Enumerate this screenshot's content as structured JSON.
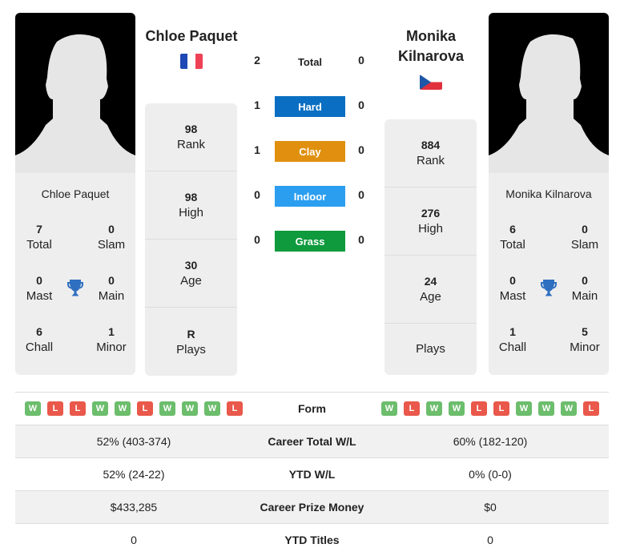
{
  "player1": {
    "name": "Chloe Paquet",
    "country": "France",
    "flag_icon": "flag-france",
    "rank": "98",
    "rank_label": "Rank",
    "high": "98",
    "high_label": "High",
    "age": "30",
    "age_label": "Age",
    "plays": "R",
    "plays_label": "Plays",
    "titles": {
      "total": "7",
      "total_label": "Total",
      "slam": "0",
      "slam_label": "Slam",
      "mast": "0",
      "mast_label": "Mast",
      "main": "0",
      "main_label": "Main",
      "chall": "6",
      "chall_label": "Chall",
      "minor": "1",
      "minor_label": "Minor"
    },
    "form": [
      "W",
      "L",
      "L",
      "W",
      "W",
      "L",
      "W",
      "W",
      "W",
      "L"
    ]
  },
  "player2": {
    "name": "Monika Kilnarova",
    "name_line1": "Monika",
    "name_line2": "Kilnarova",
    "country": "Czech Republic",
    "flag_icon": "flag-czech",
    "rank": "884",
    "rank_label": "Rank",
    "high": "276",
    "high_label": "High",
    "age": "24",
    "age_label": "Age",
    "plays": "",
    "plays_label": "Plays",
    "titles": {
      "total": "6",
      "total_label": "Total",
      "slam": "0",
      "slam_label": "Slam",
      "mast": "0",
      "mast_label": "Mast",
      "main": "0",
      "main_label": "Main",
      "chall": "1",
      "chall_label": "Chall",
      "minor": "5",
      "minor_label": "Minor"
    },
    "form": [
      "W",
      "L",
      "W",
      "W",
      "L",
      "L",
      "W",
      "W",
      "W",
      "L"
    ]
  },
  "h2h": {
    "total": {
      "label": "Total",
      "p1": "2",
      "p2": "0"
    },
    "surfaces": [
      {
        "label": "Hard",
        "p1": "1",
        "p2": "0",
        "color": "#0a6fc2"
      },
      {
        "label": "Clay",
        "p1": "1",
        "p2": "0",
        "color": "#e0900e"
      },
      {
        "label": "Indoor",
        "p1": "0",
        "p2": "0",
        "color": "#2b9ef0"
      },
      {
        "label": "Grass",
        "p1": "0",
        "p2": "0",
        "color": "#0e9a3d"
      }
    ]
  },
  "comparison": [
    {
      "label": "Form",
      "p1": "",
      "p2": ""
    },
    {
      "label": "Career Total W/L",
      "p1": "52% (403-374)",
      "p2": "60% (182-120)"
    },
    {
      "label": "YTD W/L",
      "p1": "52% (24-22)",
      "p2": "0% (0-0)"
    },
    {
      "label": "Career Prize Money",
      "p1": "$433,285",
      "p2": "$0"
    },
    {
      "label": "YTD Titles",
      "p1": "0",
      "p2": "0"
    }
  ],
  "colors": {
    "win": "#6cbd6c",
    "loss": "#e9584a",
    "trophy": "#2f6fc0"
  }
}
